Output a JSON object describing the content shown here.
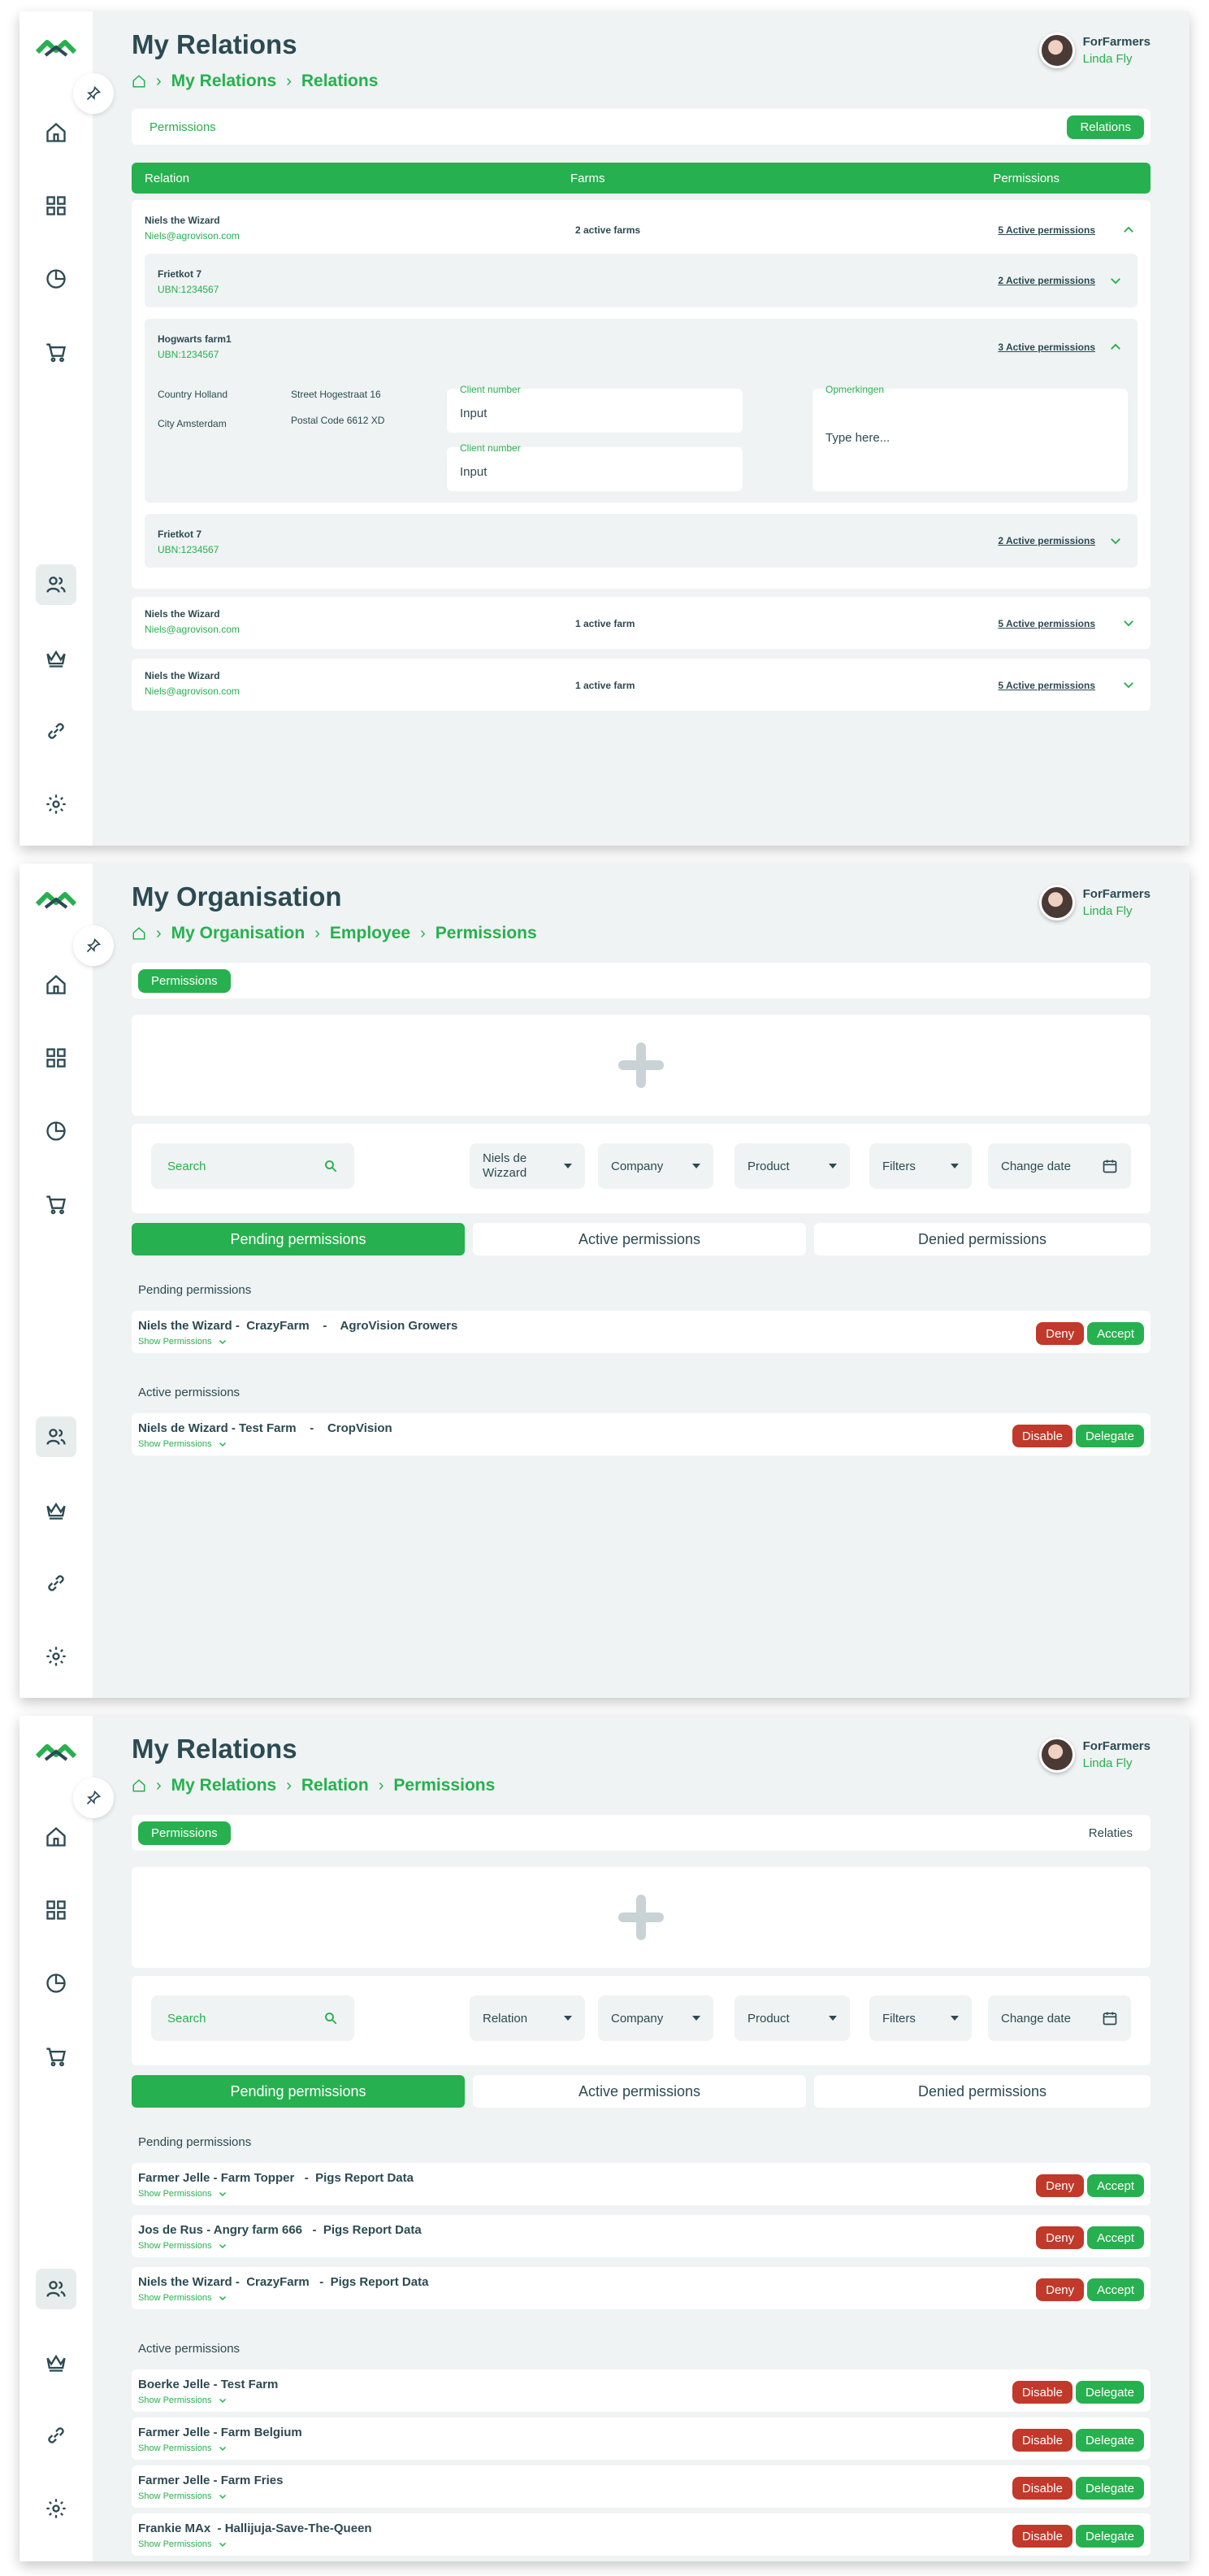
{
  "colors": {
    "accent": "#27b04f",
    "text": "#2c4a52",
    "bg": "#eff3f3",
    "deny": "#c0392b"
  },
  "icons": {
    "logo": "logo-icon",
    "home": "home-icon",
    "dashboard": "grid-icon",
    "reports": "pie-chart-icon",
    "shop": "cart-icon",
    "relations": "users-icon",
    "premium": "crown-icon",
    "links": "link-icon",
    "settings": "gear-icon",
    "pin": "pin-icon"
  },
  "user": {
    "org": "ForFarmers",
    "name": "Linda Fly"
  },
  "screen1": {
    "title": "My Relations",
    "crumbs": [
      "My Relations",
      "Relations"
    ],
    "tabs": {
      "left": "Permissions",
      "right": "Relations"
    },
    "columns": [
      "Relation",
      "Farms",
      "Permissions"
    ],
    "relations": [
      {
        "name": "Niels the Wizard",
        "email": "Niels@agrovison.com",
        "farms": "2 active farms",
        "perms": "5 Active permissions"
      },
      {
        "name": "Niels the Wizard",
        "email": "Niels@agrovison.com",
        "farms": "1 active farm",
        "perms": "5 Active permissions"
      },
      {
        "name": "Niels the Wizard",
        "email": "Niels@agrovison.com",
        "farms": "1 active farm",
        "perms": "5 Active permissions"
      }
    ],
    "farms": [
      {
        "name": "Frietkot 7",
        "ubn": "UBN:1234567",
        "perms": "2 Active permissions"
      },
      {
        "name": "Hogwarts farm1",
        "ubn": "UBN:1234567",
        "perms": "3 Active permissions"
      },
      {
        "name": "Frietkot 7",
        "ubn": "UBN:1234567",
        "perms": "2 Active permissions"
      }
    ],
    "details": {
      "country": "Country Holland",
      "city": "City Amsterdam",
      "street": "Street Hogestraat 16",
      "postal": "Postal Code 6612 XD"
    },
    "client1": {
      "label": "Client number",
      "value": "Input"
    },
    "client2": {
      "label": "Client number",
      "value": "Input"
    },
    "remarks": {
      "label": "Opmerkingen",
      "value": "Type here..."
    }
  },
  "screen2": {
    "title": "My Organisation",
    "crumbs": [
      "My Organisation",
      "Employee",
      "Permissions"
    ],
    "tab": "Permissions",
    "search": "Search",
    "filters": [
      "Niels de Wizzard",
      "Company",
      "Product",
      "Filters"
    ],
    "change_date": "Change date",
    "segs": [
      "Pending permissions",
      "Active permissions",
      "Denied permissions"
    ],
    "pending_title": "Pending permissions",
    "active_title": "Active permissions",
    "pending": [
      {
        "text": "Niels the Wizard -  CrazyFarm    -    AgroVision Growers"
      }
    ],
    "active": [
      {
        "text": "Niels de Wizard - Test Farm    -    CropVision"
      }
    ],
    "show": "Show Permissions",
    "deny": "Deny",
    "accept": "Accept",
    "disable": "Disable",
    "delegate": "Delegate"
  },
  "screen3": {
    "title": "My Relations",
    "crumbs": [
      "My Relations",
      "Relation",
      "Permissions"
    ],
    "tab": "Permissions",
    "tab_right": "Relaties",
    "search": "Search",
    "filters": [
      "Relation",
      "Company",
      "Product",
      "Filters"
    ],
    "change_date": "Change date",
    "segs": [
      "Pending permissions",
      "Active permissions",
      "Denied permissions"
    ],
    "pending_title": "Pending permissions",
    "active_title": "Active permissions",
    "pending": [
      {
        "text": "Farmer Jelle - Farm Topper   -  Pigs Report Data"
      },
      {
        "text": "Jos de Rus - Angry farm 666   -  Pigs Report Data"
      },
      {
        "text": "Niels the Wizard -  CrazyFarm   -  Pigs Report Data"
      }
    ],
    "active": [
      {
        "text": "Boerke Jelle - Test Farm"
      },
      {
        "text": "Farmer Jelle - Farm Belgium"
      },
      {
        "text": "Farmer Jelle - Farm Fries"
      },
      {
        "text": "Frankie MAx  - Hallijuja-Save-The-Queen"
      }
    ],
    "show": "Show Permissions",
    "deny": "Deny",
    "accept": "Accept",
    "disable": "Disable",
    "delegate": "Delegate"
  }
}
